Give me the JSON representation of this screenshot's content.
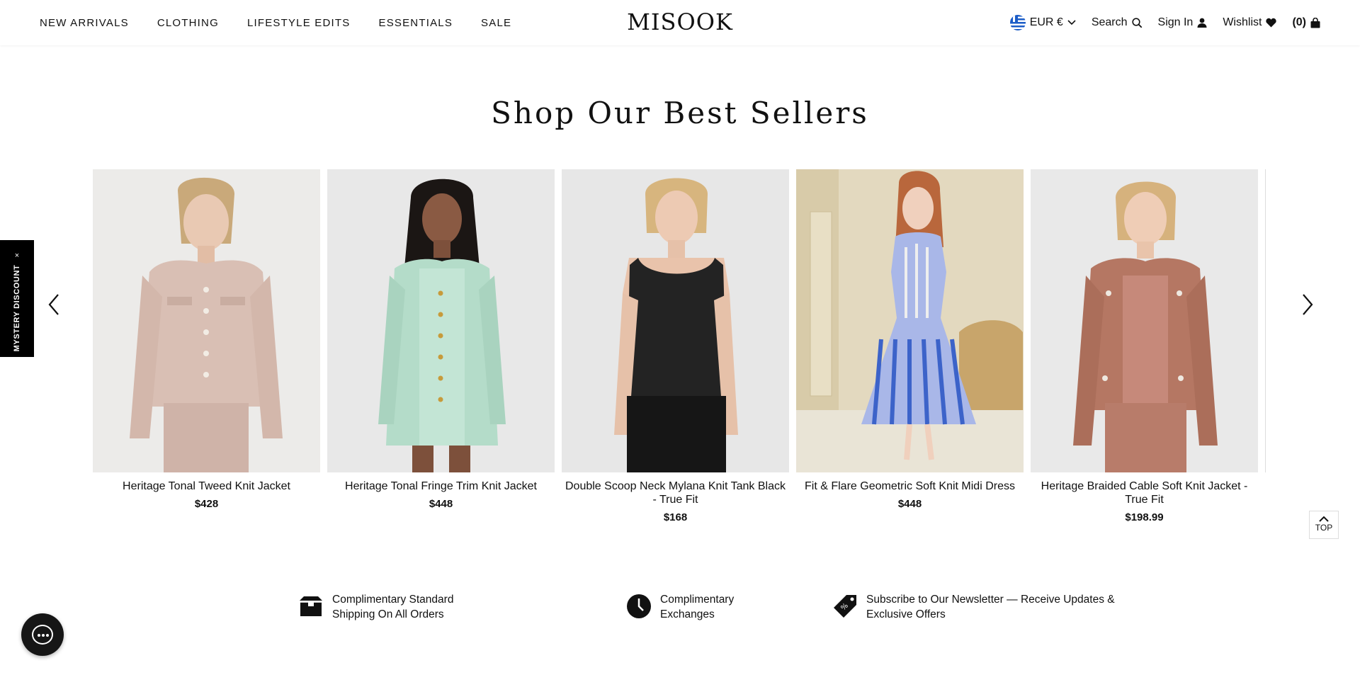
{
  "header": {
    "nav": [
      "NEW ARRIVALS",
      "CLOTHING",
      "LIFESTYLE EDITS",
      "ESSENTIALS",
      "SALE"
    ],
    "logo": "MISOOK",
    "currency": "EUR €",
    "search": "Search",
    "sign_in": "Sign In",
    "wishlist": "Wishlist",
    "cart_count": "(0)"
  },
  "section_title": "Shop Our Best Sellers",
  "products": [
    {
      "name": "Heritage Tonal Tweed Knit Jacket",
      "price": "$428"
    },
    {
      "name": "Heritage Tonal Fringe Trim Knit Jacket",
      "price": "$448"
    },
    {
      "name": "Double Scoop Neck Mylana Knit Tank Black - True Fit",
      "price": "$168"
    },
    {
      "name": "Fit & Flare Geometric Soft Knit Midi Dress",
      "price": "$448"
    },
    {
      "name": "Heritage Braided Cable Soft Knit Jacket - True Fit",
      "price": "$198.99"
    }
  ],
  "mystery_tab": {
    "label": "MYSTERY DISCOUNT",
    "close": "×"
  },
  "back_to_top": "TOP",
  "features": [
    {
      "icon": "box-icon",
      "text_line1": "Complimentary Standard",
      "text_line2": "Shipping On All Orders"
    },
    {
      "icon": "clock-icon",
      "text_line1": "Complimentary",
      "text_line2": "Exchanges"
    },
    {
      "icon": "tag-icon",
      "text_line1": "Subscribe to Our Newsletter — Receive Updates &",
      "text_line2": "Exclusive Offers"
    }
  ],
  "colors": {
    "accent": "#000000",
    "background": "#ffffff",
    "text": "#111111"
  }
}
